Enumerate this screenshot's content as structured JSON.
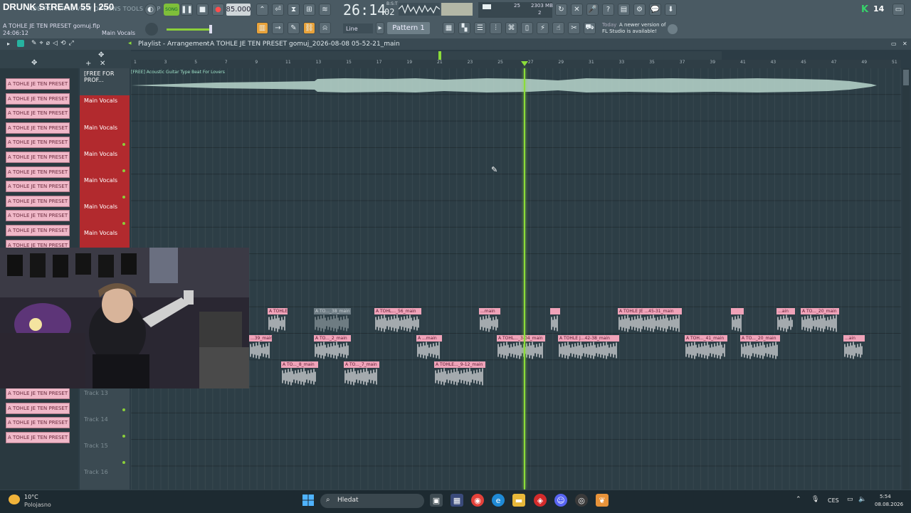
{
  "stream": {
    "title": "DRUNK STREAM 55 | 250"
  },
  "menu": {
    "overlay_text": "ADD PATTERNS VIEW OPTIONS TOOLS HELP"
  },
  "project": {
    "file": "A TOHLE JE TEN PRESET gomuj.flp",
    "time": "24:06:12",
    "channel": "Main Vocals"
  },
  "transport": {
    "song_label": "SONG",
    "tempo": "85.000",
    "clock_main": "26:14",
    "clock_sub": "02",
    "clock_sub_label": "B:S:T"
  },
  "cpu": {
    "voices": "25",
    "memory": "2303 MB",
    "poly": "2"
  },
  "snap": {
    "mode": "Line"
  },
  "pattern": {
    "current": "Pattern 1"
  },
  "news": {
    "date": "Today",
    "title": "A newer version of",
    "message": "FL Studio is available!"
  },
  "brand": {
    "logo": "K",
    "version": "14"
  },
  "playlist": {
    "title": "Playlist - Arrangement",
    "separator": "›",
    "arrangement": "A TOHLE JE TEN PRESET gomuj_2026-08-08 05-52-21_main"
  },
  "ruler": {
    "bars": [
      1,
      3,
      5,
      7,
      9,
      11,
      13,
      15,
      17,
      19,
      21,
      23,
      25,
      27,
      29,
      31,
      33,
      35,
      37,
      39,
      41,
      43,
      45,
      47,
      49,
      51
    ]
  },
  "patterns": {
    "items": [
      "A TOHLE JE TEN PRESET g",
      "A TOHLE JE TEN PRESET g",
      "A TOHLE JE TEN PRESET g",
      "A TOHLE JE TEN PRESET g",
      "A TOHLE JE TEN PRESET g",
      "A TOHLE JE TEN PRESET g",
      "A TOHLE JE TEN PRESET g",
      "A TOHLE JE TEN PRESET g",
      "A TOHLE JE TEN PRESET g",
      "A TOHLE JE TEN PRESET g",
      "A TOHLE JE TEN PRESET g",
      "A TOHLE JE TEN PRESET g",
      "A TOHLE JE TEN PRESET g",
      "A TOHLE JE TEN PRESET g",
      "A TOHLE JE TEN PRESET g",
      "A TOHLE JE TEN PRESET g"
    ]
  },
  "tracks": {
    "t1": "[FREE FOR PROF...",
    "t2": "Main Vocals",
    "t3": "Main Vocals",
    "t4": "Main Vocals",
    "t5": "Main Vocals",
    "t6": "Main Vocals",
    "t7": "Main Vocals",
    "t13": "Track 13",
    "t14": "Track 14",
    "t15": "Track 15",
    "t16": "Track 16"
  },
  "audio_clip": {
    "label": "[FREE] Acoustic Guitar Type Beat For Lovers"
  },
  "clips": {
    "c1": "A TOHLE JE ...ain",
    "c2": "A TO..._38_main",
    "c3": "A TOHL..._56_main",
    "c4": "...main",
    "c5": "",
    "c6": "A TOHLE JE ...45-31_main",
    "c7": "",
    "c8": "...ain",
    "c9": "A TO..._20_main",
    "c10": "...39_main",
    "c11": "A TO..._2_main",
    "c12": "A ...main",
    "c13": "A TOHL..._3-04_main",
    "c14": "A TOHLE J...42-38_main",
    "c15": "A TOH..._41_main",
    "c16": "A TO..._20_main",
    "c17": "...ain",
    "c18": "A TO..._8_main",
    "c19": "A TO..._7_main",
    "c20": "A TOHLE..._9-12_main"
  },
  "taskbar": {
    "weather_temp": "10°C",
    "weather_desc": "Polojasno",
    "search_placeholder": "Hledat",
    "lang": "CES",
    "time": "5:54",
    "date": "08.08.2026"
  },
  "colors": {
    "accent": "#8bdc3a",
    "clip_header": "#f0a3b9",
    "track_red": "#b22a2e",
    "grid_bg": "#2d3e46"
  }
}
